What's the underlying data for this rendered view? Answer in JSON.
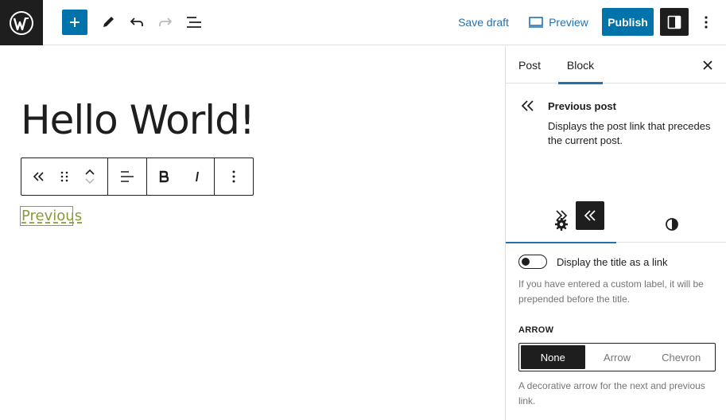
{
  "topbar": {
    "save_draft": "Save draft",
    "preview": "Preview",
    "publish": "Publish"
  },
  "editor": {
    "post_title": "Hello World!",
    "previous_link": "Previous"
  },
  "sidebar": {
    "tabs": [
      "Post",
      "Block"
    ],
    "active_tab": "Block",
    "block": {
      "name": "Previous post",
      "description": "Displays the post link that precedes the current post."
    },
    "toggle": {
      "label": "Display the title as a link",
      "checked": false,
      "help": "If you have entered a custom label, it will be prepended before the title."
    },
    "arrow": {
      "label": "ARROW",
      "options": [
        "None",
        "Arrow",
        "Chevron"
      ],
      "selected": "None",
      "help": "A decorative arrow for the next and previous link."
    }
  },
  "colors": {
    "accent": "#0073aa",
    "dark": "#1e1e1e",
    "link": "#8a9a3a"
  }
}
